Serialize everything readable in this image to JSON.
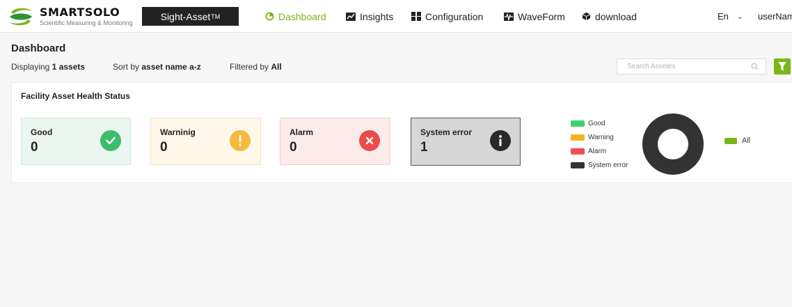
{
  "brand": {
    "name": "SMARTSOLO",
    "tagline": "Scientific Measuring & Monitoring",
    "product": "Sight-Asset",
    "trademark": "TM",
    "accent_color": "#7cb518"
  },
  "nav": {
    "dashboard": {
      "label": "Dashboard",
      "icon": "pie-chart-icon",
      "active": true
    },
    "insights": {
      "label": "Insights",
      "icon": "line-chart-icon"
    },
    "configuration": {
      "label": "Configuration",
      "icon": "grid-icon"
    },
    "waveform": {
      "label": "WaveForm",
      "icon": "waveform-icon"
    },
    "download": {
      "label": "download",
      "icon": "cube-icon"
    }
  },
  "header": {
    "language": "En",
    "user": "userNam"
  },
  "page": {
    "title": "Dashboard",
    "displaying_prefix": "Displaying",
    "displaying_value": "1 assets",
    "sort_prefix": "Sort by",
    "sort_value": "asset name a-z",
    "filter_prefix": "Filtered by",
    "filter_value": "All",
    "search_placeholder": "Search Assetes"
  },
  "health": {
    "title": "Facility Asset Health Status",
    "cards": {
      "good": {
        "label": "Good",
        "value": "0",
        "icon": "check-circle-icon",
        "color": "#3dbc6c"
      },
      "warning": {
        "label": "Warninig",
        "value": "0",
        "icon": "exclamation-circle-icon",
        "color": "#f6b93b"
      },
      "alarm": {
        "label": "Alarm",
        "value": "0",
        "icon": "x-circle-icon",
        "color": "#ea4c4c"
      },
      "error": {
        "label": "System error",
        "value": "1",
        "icon": "info-circle-icon",
        "color": "#2a2a2a"
      }
    },
    "legend": {
      "good": {
        "label": "Good",
        "color": "#3dd26b"
      },
      "warning": {
        "label": "Warning",
        "color": "#f6b520"
      },
      "alarm": {
        "label": "Alarm",
        "color": "#f05050"
      },
      "error": {
        "label": "System error",
        "color": "#333333"
      }
    },
    "legend_all": "All",
    "donut": {
      "good": 0,
      "warning": 0,
      "alarm": 0,
      "system_error": 1
    }
  }
}
